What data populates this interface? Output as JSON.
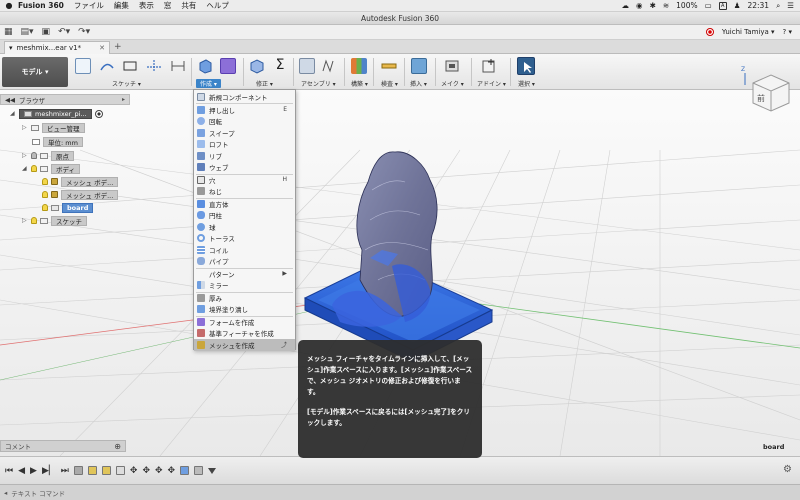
{
  "mac_menubar": {
    "apple": "",
    "app_name": "Fusion 360",
    "menus": [
      "ファイル",
      "編集",
      "表示",
      "窓",
      "共有",
      "ヘルプ"
    ],
    "battery": "100%",
    "input_badge": "A",
    "clock": "22:31"
  },
  "window": {
    "title": "Autodesk Fusion 360"
  },
  "quick_access": {
    "user": "Yuichi Tamiya ▾",
    "help": "? ▾"
  },
  "document_tab": {
    "name": "meshmix...ear v1*"
  },
  "toolbar": {
    "workspace": "モデル ▾",
    "groups": [
      "スケッチ ▾",
      "作成 ▾",
      "修正 ▾",
      "アセンブリ ▾",
      "構築 ▾",
      "検査 ▾",
      "挿入 ▾",
      "メイク ▾",
      "アドイン ▾",
      "選択 ▾"
    ]
  },
  "browser": {
    "header": "ブラウザ",
    "root": "meshmixer_pi...",
    "nodes": {
      "view_mgmt": "ビュー管理",
      "units": "単位: mm",
      "origin": "原点",
      "bodies": "ボディ",
      "mesh1": "メッシュ ボデ...",
      "mesh2": "メッシュ ボデ...",
      "board": "board",
      "sketches": "スケッチ"
    }
  },
  "create_menu": {
    "items": [
      {
        "label": "新規コンポーネント",
        "shortcut": ""
      },
      {
        "label": "押し出し",
        "shortcut": "E"
      },
      {
        "label": "回転",
        "shortcut": ""
      },
      {
        "label": "スイープ",
        "shortcut": ""
      },
      {
        "label": "ロフト",
        "shortcut": ""
      },
      {
        "label": "リブ",
        "shortcut": ""
      },
      {
        "label": "ウェブ",
        "shortcut": ""
      },
      {
        "label": "穴",
        "shortcut": "H"
      },
      {
        "label": "ねじ",
        "shortcut": ""
      },
      {
        "label": "直方体",
        "shortcut": ""
      },
      {
        "label": "円柱",
        "shortcut": ""
      },
      {
        "label": "球",
        "shortcut": ""
      },
      {
        "label": "トーラス",
        "shortcut": ""
      },
      {
        "label": "コイル",
        "shortcut": ""
      },
      {
        "label": "パイプ",
        "shortcut": ""
      },
      {
        "label": "パターン",
        "shortcut": "▶"
      },
      {
        "label": "ミラー",
        "shortcut": ""
      },
      {
        "label": "厚み",
        "shortcut": ""
      },
      {
        "label": "境界塗り潰し",
        "shortcut": ""
      },
      {
        "label": "フォームを作成",
        "shortcut": ""
      },
      {
        "label": "基準フィーチャを作成",
        "shortcut": ""
      },
      {
        "label": "メッシュを作成",
        "shortcut": ""
      }
    ]
  },
  "tooltip": {
    "para1": "メッシュ フィーチャをタイムラインに挿入して、[メッシュ]作業スペースに入ります。[メッシュ]作業スペースで、メッシュ ジオメトリの修正および修復を行います。",
    "para2": "[モデル]作業スペースに戻るには[メッシュ完了]をクリックします。"
  },
  "comments": {
    "label": "コメント"
  },
  "viewport": {
    "selected_body": "board",
    "viewcube_face": "前"
  },
  "text_command": {
    "label": "テキスト コマンド"
  },
  "colors": {
    "accent": "#3b84c9",
    "mesh": "#4b6fe0",
    "board": "#2f63d8"
  }
}
